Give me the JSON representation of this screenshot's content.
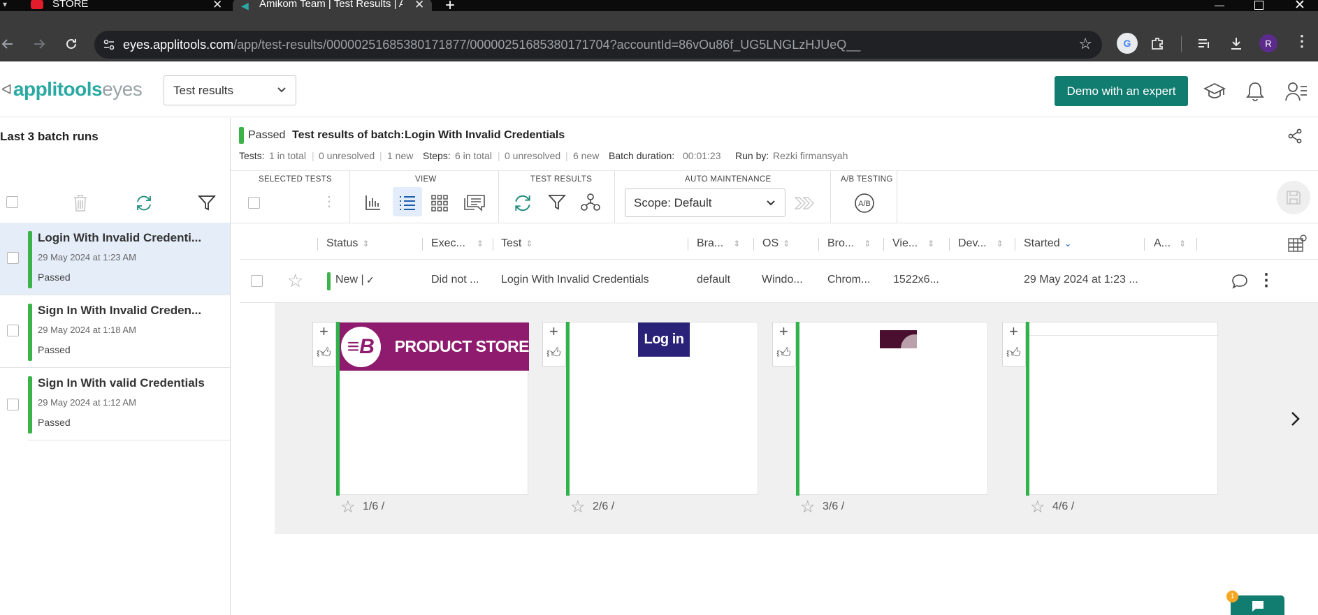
{
  "browser": {
    "tabs": [
      {
        "title": "STORE",
        "active": false
      },
      {
        "title": "Amikom Team | Test Results | Ap",
        "active": true
      }
    ],
    "url_host": "eyes.applitools.com",
    "url_path": "/app/test-results/00000251685380171877/00000251685380171704?accountId=86vOu86f_UG5LNGLzHJUeQ__",
    "profile_initial": "R"
  },
  "app": {
    "logo_part1": "applitools",
    "logo_part2": "eyes",
    "page_selector": "Test results",
    "demo_button": "Demo with an expert"
  },
  "sidebar": {
    "title": "Last 3 batch runs",
    "batches": [
      {
        "name": "Login With Invalid Credenti...",
        "date": "29 May 2024 at 1:23 AM",
        "status": "Passed",
        "selected": true
      },
      {
        "name": "Sign In With Invalid Creden...",
        "date": "29 May 2024 at 1:18 AM",
        "status": "Passed",
        "selected": false
      },
      {
        "name": "Sign In With valid Credentials",
        "date": "29 May 2024 at 1:12 AM",
        "status": "Passed",
        "selected": false
      }
    ]
  },
  "batch": {
    "status": "Passed",
    "title_label": "Test results of batch:",
    "title_name": "Login With Invalid Credentials",
    "tests_label": "Tests:",
    "tests_total": "1 in total",
    "tests_unresolved": "0 unresolved",
    "tests_new": "1 new",
    "steps_label": "Steps:",
    "steps_total": "6 in total",
    "steps_unresolved": "0 unresolved",
    "steps_new": "6 new",
    "duration_label": "Batch duration:",
    "duration": "00:01:23",
    "runby_label": "Run by:",
    "runby": "Rezki firmansyah"
  },
  "toolbar": {
    "selected_tests": "SELECTED TESTS",
    "view": "VIEW",
    "test_results": "TEST RESULTS",
    "auto_maintenance": "AUTO MAINTENANCE",
    "ab_testing": "A/B TESTING",
    "scope": "Scope: Default"
  },
  "table": {
    "columns": [
      "Status",
      "Exec...",
      "Test",
      "Bra...",
      "OS",
      "Bro...",
      "Vie...",
      "Dev...",
      "Started",
      "A..."
    ],
    "row": {
      "status": "New |",
      "exec": "Did not ...",
      "test": "Login With Invalid Credentials",
      "branch": "default",
      "os": "Windo...",
      "browser": "Chrom...",
      "viewport": "1522x6...",
      "device": "",
      "started": "29 May 2024 at 1:23 ..."
    }
  },
  "thumbnails": [
    {
      "label": "1/6 /",
      "caption": "PRODUCT STORE"
    },
    {
      "label": "2/6 /",
      "caption": "Log in"
    },
    {
      "label": "3/6 /",
      "caption": ""
    },
    {
      "label": "4/6 /",
      "caption": ""
    }
  ],
  "chat": {
    "badge": "1"
  },
  "colors": {
    "accent": "#117c70",
    "passed": "#3cb34a",
    "brand_purple": "#8e1b6d",
    "login_blue": "#2a2178"
  }
}
